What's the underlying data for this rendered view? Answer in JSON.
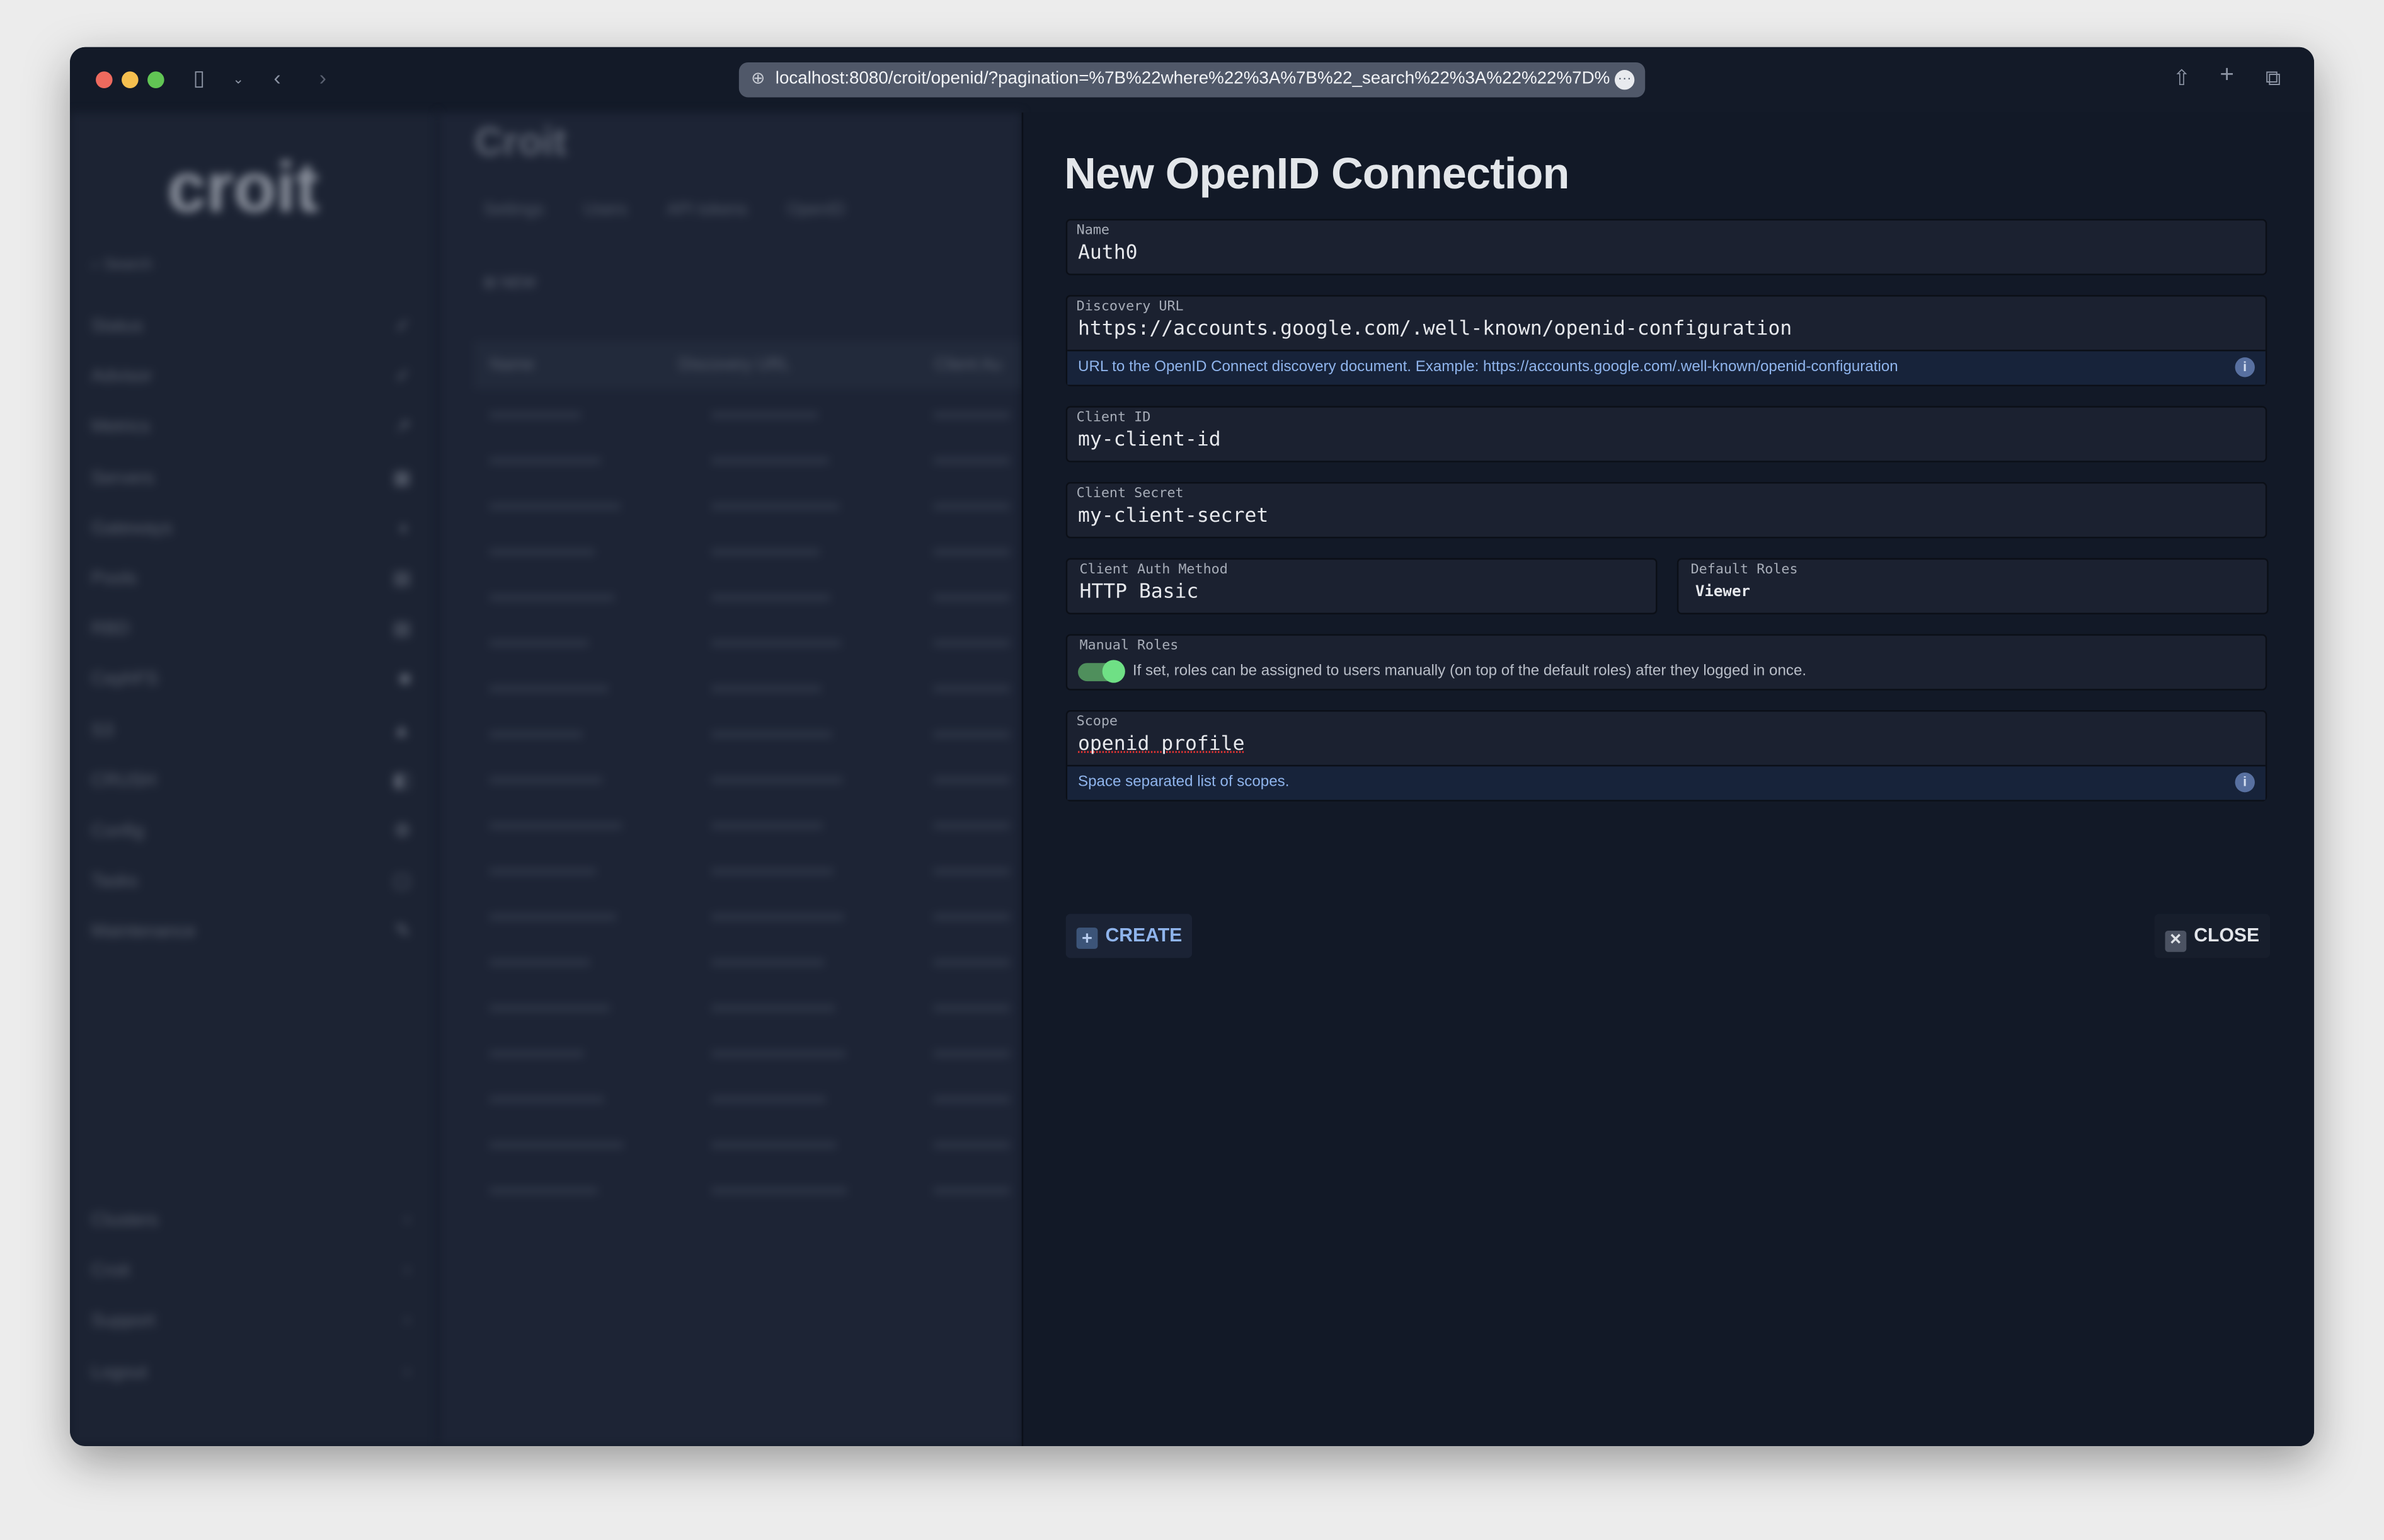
{
  "browser": {
    "url": "localhost:8080/croit/openid/?pagination=%7B%22where%22%3A%7B%22_search%22%3A%22%22%7D%"
  },
  "colors": {
    "close": "#ed6a5e",
    "minimize": "#f5bf4f",
    "maximize": "#61c554",
    "toggle_on": "#6fe085",
    "hint_text": "#8fb4ec"
  },
  "background": {
    "logo": "croit",
    "search_placeholder": "Search",
    "sidebar": [
      "Status",
      "Advisor",
      "Metrics",
      "Servers",
      "Gateways",
      "Pools",
      "RBD",
      "CephFS",
      "S3",
      "CRUSH",
      "Config",
      "Tasks",
      "Maintenance"
    ],
    "sidebar_bottom": [
      "Clusters",
      "Croit",
      "Support",
      "Logout"
    ],
    "page_title": "Croit",
    "tabs": [
      "Settings",
      "Users",
      "API tokens",
      "OpenID"
    ],
    "new_label": "NEW",
    "columns": [
      "Name",
      "Discovery URL",
      "Client Au"
    ]
  },
  "form": {
    "title": "New OpenID Connection",
    "name": {
      "label": "Name",
      "value": "Auth0"
    },
    "discovery_url": {
      "label": "Discovery URL",
      "value": "https://accounts.google.com/.well-known/openid-configuration",
      "hint": "URL to the OpenID Connect discovery document. Example: https://accounts.google.com/.well-known/openid-configuration"
    },
    "client_id": {
      "label": "Client ID",
      "value": "my-client-id"
    },
    "client_secret": {
      "label": "Client Secret",
      "value": "my-client-secret"
    },
    "client_auth_method": {
      "label": "Client Auth Method",
      "value": "HTTP Basic"
    },
    "default_roles": {
      "label": "Default Roles",
      "value": "Viewer"
    },
    "manual_roles": {
      "label": "Manual Roles",
      "enabled": true,
      "description": "If set, roles can be assigned to users manually (on top of the default roles) after they logged in once."
    },
    "scope": {
      "label": "Scope",
      "value": "openid profile",
      "hint": "Space separated list of scopes."
    },
    "create_label": "CREATE",
    "close_label": "CLOSE"
  }
}
